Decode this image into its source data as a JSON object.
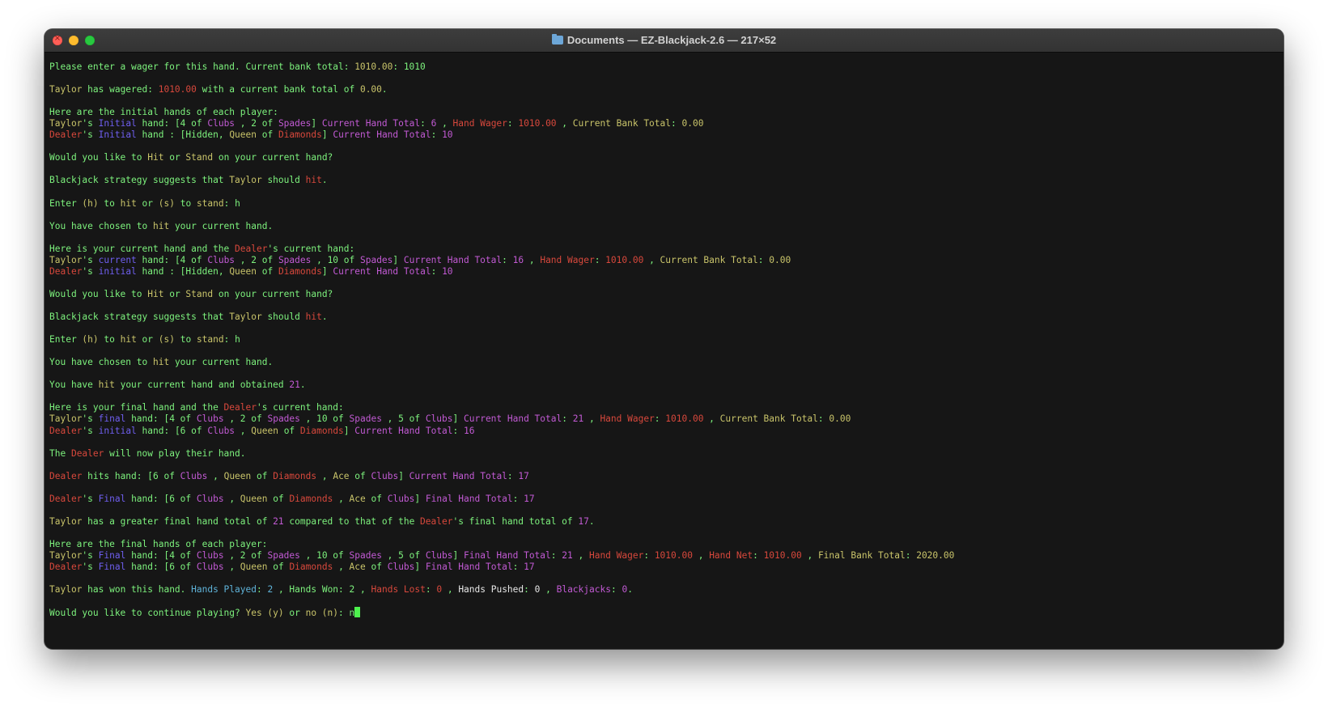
{
  "window": {
    "title": "Documents — EZ-Blackjack-2.6 — 217×52"
  },
  "colors": {
    "green": "#7df27d",
    "yellow": "#c9c46a",
    "red": "#d8483c",
    "purple": "#c25ad4",
    "blue": "#6f5ff0",
    "cyan": "#5fb3d9"
  },
  "terminal": {
    "lines": [
      [
        [
          "g",
          "Please enter a wager for this hand. Current bank total: "
        ],
        [
          "y",
          "1010.00"
        ],
        [
          "g",
          ": 1010"
        ]
      ],
      [],
      [
        [
          "y",
          "Taylor"
        ],
        [
          "g",
          " has wagered: "
        ],
        [
          "r",
          "1010.00"
        ],
        [
          "g",
          " with a current bank total of "
        ],
        [
          "y",
          "0.00"
        ],
        [
          "g",
          "."
        ]
      ],
      [],
      [
        [
          "g",
          "Here are the initial hands of each player:"
        ]
      ],
      [
        [
          "y",
          "Taylor"
        ],
        [
          "g",
          "'s "
        ],
        [
          "b",
          "Initial"
        ],
        [
          "g",
          " hand: [4 of "
        ],
        [
          "p",
          "Clubs"
        ],
        [
          "g",
          " , 2 of "
        ],
        [
          "p",
          "Spades"
        ],
        [
          "g",
          "] "
        ],
        [
          "p",
          "Current Hand Total"
        ],
        [
          "g",
          ": "
        ],
        [
          "p",
          "6"
        ],
        [
          "g",
          " , "
        ],
        [
          "r",
          "Hand Wager"
        ],
        [
          "g",
          ": "
        ],
        [
          "r",
          "1010.00"
        ],
        [
          "g",
          " , "
        ],
        [
          "y",
          "Current Bank Total"
        ],
        [
          "g",
          ": "
        ],
        [
          "y",
          "0.00"
        ]
      ],
      [
        [
          "r",
          "Dealer"
        ],
        [
          "g",
          "'s "
        ],
        [
          "b",
          "Initial"
        ],
        [
          "g",
          " hand : [Hidden, "
        ],
        [
          "y",
          "Queen"
        ],
        [
          "g",
          " of "
        ],
        [
          "r",
          "Diamonds"
        ],
        [
          "g",
          "] "
        ],
        [
          "p",
          "Current Hand Total"
        ],
        [
          "g",
          ": "
        ],
        [
          "p",
          "10"
        ]
      ],
      [],
      [
        [
          "g",
          "Would you like to "
        ],
        [
          "y",
          "Hit"
        ],
        [
          "g",
          " or "
        ],
        [
          "y",
          "Stand"
        ],
        [
          "g",
          " on your current hand?"
        ]
      ],
      [],
      [
        [
          "g",
          "Blackjack strategy suggests that "
        ],
        [
          "y",
          "Taylor"
        ],
        [
          "g",
          " should "
        ],
        [
          "r",
          "hit"
        ],
        [
          "g",
          "."
        ]
      ],
      [],
      [
        [
          "g",
          "Enter "
        ],
        [
          "y",
          "(h)"
        ],
        [
          "g",
          " to "
        ],
        [
          "y",
          "hit"
        ],
        [
          "g",
          " or "
        ],
        [
          "y",
          "(s)"
        ],
        [
          "g",
          " to "
        ],
        [
          "y",
          "stand"
        ],
        [
          "g",
          ": h"
        ]
      ],
      [],
      [
        [
          "g",
          "You have chosen to "
        ],
        [
          "y",
          "hit"
        ],
        [
          "g",
          " your current hand."
        ]
      ],
      [],
      [
        [
          "g",
          "Here is your current hand and the "
        ],
        [
          "r",
          "Dealer"
        ],
        [
          "g",
          "'s current hand:"
        ]
      ],
      [
        [
          "y",
          "Taylor"
        ],
        [
          "g",
          "'s "
        ],
        [
          "b",
          "current"
        ],
        [
          "g",
          " hand: [4 of "
        ],
        [
          "p",
          "Clubs"
        ],
        [
          "g",
          " , 2 of "
        ],
        [
          "p",
          "Spades"
        ],
        [
          "g",
          " , 10 of "
        ],
        [
          "p",
          "Spades"
        ],
        [
          "g",
          "] "
        ],
        [
          "p",
          "Current Hand Total"
        ],
        [
          "g",
          ": "
        ],
        [
          "p",
          "16"
        ],
        [
          "g",
          " , "
        ],
        [
          "r",
          "Hand Wager"
        ],
        [
          "g",
          ": "
        ],
        [
          "r",
          "1010.00"
        ],
        [
          "g",
          " , "
        ],
        [
          "y",
          "Current Bank Total"
        ],
        [
          "g",
          ": "
        ],
        [
          "y",
          "0.00"
        ]
      ],
      [
        [
          "r",
          "Dealer"
        ],
        [
          "g",
          "'s "
        ],
        [
          "b",
          "initial"
        ],
        [
          "g",
          " hand : [Hidden, "
        ],
        [
          "y",
          "Queen"
        ],
        [
          "g",
          " of "
        ],
        [
          "r",
          "Diamonds"
        ],
        [
          "g",
          "] "
        ],
        [
          "p",
          "Current Hand Total"
        ],
        [
          "g",
          ": "
        ],
        [
          "p",
          "10"
        ]
      ],
      [],
      [
        [
          "g",
          "Would you like to "
        ],
        [
          "y",
          "Hit"
        ],
        [
          "g",
          " or "
        ],
        [
          "y",
          "Stand"
        ],
        [
          "g",
          " on your current hand?"
        ]
      ],
      [],
      [
        [
          "g",
          "Blackjack strategy suggests that "
        ],
        [
          "y",
          "Taylor"
        ],
        [
          "g",
          " should "
        ],
        [
          "r",
          "hit"
        ],
        [
          "g",
          "."
        ]
      ],
      [],
      [
        [
          "g",
          "Enter "
        ],
        [
          "y",
          "(h)"
        ],
        [
          "g",
          " to "
        ],
        [
          "y",
          "hit"
        ],
        [
          "g",
          " or "
        ],
        [
          "y",
          "(s)"
        ],
        [
          "g",
          " to "
        ],
        [
          "y",
          "stand"
        ],
        [
          "g",
          ": h"
        ]
      ],
      [],
      [
        [
          "g",
          "You have chosen to "
        ],
        [
          "y",
          "hit"
        ],
        [
          "g",
          " your current hand."
        ]
      ],
      [],
      [
        [
          "g",
          "You have "
        ],
        [
          "y",
          "hit"
        ],
        [
          "g",
          " your current hand and obtained "
        ],
        [
          "p",
          "21"
        ],
        [
          "g",
          "."
        ]
      ],
      [],
      [
        [
          "g",
          "Here is your final hand and the "
        ],
        [
          "r",
          "Dealer"
        ],
        [
          "g",
          "'s current hand:"
        ]
      ],
      [
        [
          "y",
          "Taylor"
        ],
        [
          "g",
          "'s "
        ],
        [
          "b",
          "final"
        ],
        [
          "g",
          " hand: [4 of "
        ],
        [
          "p",
          "Clubs"
        ],
        [
          "g",
          " , 2 of "
        ],
        [
          "p",
          "Spades"
        ],
        [
          "g",
          " , 10 of "
        ],
        [
          "p",
          "Spades"
        ],
        [
          "g",
          " , 5 of "
        ],
        [
          "p",
          "Clubs"
        ],
        [
          "g",
          "] "
        ],
        [
          "p",
          "Current Hand Total"
        ],
        [
          "g",
          ": "
        ],
        [
          "p",
          "21"
        ],
        [
          "g",
          " , "
        ],
        [
          "r",
          "Hand Wager"
        ],
        [
          "g",
          ": "
        ],
        [
          "r",
          "1010.00"
        ],
        [
          "g",
          " , "
        ],
        [
          "y",
          "Current Bank Total"
        ],
        [
          "g",
          ": "
        ],
        [
          "y",
          "0.00"
        ]
      ],
      [
        [
          "r",
          "Dealer"
        ],
        [
          "g",
          "'s "
        ],
        [
          "b",
          "initial"
        ],
        [
          "g",
          " hand: [6 of "
        ],
        [
          "p",
          "Clubs"
        ],
        [
          "g",
          " , "
        ],
        [
          "y",
          "Queen"
        ],
        [
          "g",
          " of "
        ],
        [
          "r",
          "Diamonds"
        ],
        [
          "g",
          "] "
        ],
        [
          "p",
          "Current Hand Total"
        ],
        [
          "g",
          ": "
        ],
        [
          "p",
          "16"
        ]
      ],
      [],
      [
        [
          "g",
          "The "
        ],
        [
          "r",
          "Dealer"
        ],
        [
          "g",
          " will now play their hand."
        ]
      ],
      [],
      [
        [
          "r",
          "Dealer"
        ],
        [
          "g",
          " hits hand: [6 of "
        ],
        [
          "p",
          "Clubs"
        ],
        [
          "g",
          " , "
        ],
        [
          "y",
          "Queen"
        ],
        [
          "g",
          " of "
        ],
        [
          "r",
          "Diamonds"
        ],
        [
          "g",
          " , "
        ],
        [
          "y",
          "Ace"
        ],
        [
          "g",
          " of "
        ],
        [
          "p",
          "Clubs"
        ],
        [
          "g",
          "] "
        ],
        [
          "p",
          "Current Hand Total"
        ],
        [
          "g",
          ": "
        ],
        [
          "p",
          "17"
        ]
      ],
      [],
      [
        [
          "r",
          "Dealer"
        ],
        [
          "g",
          "'s "
        ],
        [
          "b",
          "Final"
        ],
        [
          "g",
          " hand: [6 of "
        ],
        [
          "p",
          "Clubs"
        ],
        [
          "g",
          " , "
        ],
        [
          "y",
          "Queen"
        ],
        [
          "g",
          " of "
        ],
        [
          "r",
          "Diamonds"
        ],
        [
          "g",
          " , "
        ],
        [
          "y",
          "Ace"
        ],
        [
          "g",
          " of "
        ],
        [
          "p",
          "Clubs"
        ],
        [
          "g",
          "] "
        ],
        [
          "p",
          "Final Hand Total"
        ],
        [
          "g",
          ": "
        ],
        [
          "p",
          "17"
        ]
      ],
      [],
      [
        [
          "y",
          "Taylor"
        ],
        [
          "g",
          " has a greater final hand total of "
        ],
        [
          "p",
          "21"
        ],
        [
          "g",
          " compared to that of the "
        ],
        [
          "r",
          "Dealer"
        ],
        [
          "g",
          "'s final hand total of "
        ],
        [
          "p",
          "17"
        ],
        [
          "g",
          "."
        ]
      ],
      [],
      [
        [
          "g",
          "Here are the final hands of each player:"
        ]
      ],
      [
        [
          "y",
          "Taylor"
        ],
        [
          "g",
          "'s "
        ],
        [
          "b",
          "Final"
        ],
        [
          "g",
          " hand: [4 of "
        ],
        [
          "p",
          "Clubs"
        ],
        [
          "g",
          " , 2 of "
        ],
        [
          "p",
          "Spades"
        ],
        [
          "g",
          " , 10 of "
        ],
        [
          "p",
          "Spades"
        ],
        [
          "g",
          " , 5 of "
        ],
        [
          "p",
          "Clubs"
        ],
        [
          "g",
          "] "
        ],
        [
          "p",
          "Final Hand Total"
        ],
        [
          "g",
          ": "
        ],
        [
          "p",
          "21"
        ],
        [
          "g",
          " , "
        ],
        [
          "r",
          "Hand Wager"
        ],
        [
          "g",
          ": "
        ],
        [
          "r",
          "1010.00"
        ],
        [
          "g",
          " , "
        ],
        [
          "r",
          "Hand Net"
        ],
        [
          "g",
          ": "
        ],
        [
          "r",
          "1010.00"
        ],
        [
          "g",
          " , "
        ],
        [
          "y",
          "Final Bank Total"
        ],
        [
          "g",
          ": "
        ],
        [
          "y",
          "2020.00"
        ]
      ],
      [
        [
          "r",
          "Dealer"
        ],
        [
          "g",
          "'s "
        ],
        [
          "b",
          "Final"
        ],
        [
          "g",
          " hand: [6 of "
        ],
        [
          "p",
          "Clubs"
        ],
        [
          "g",
          " , "
        ],
        [
          "y",
          "Queen"
        ],
        [
          "g",
          " of "
        ],
        [
          "r",
          "Diamonds"
        ],
        [
          "g",
          " , "
        ],
        [
          "y",
          "Ace"
        ],
        [
          "g",
          " of "
        ],
        [
          "p",
          "Clubs"
        ],
        [
          "g",
          "] "
        ],
        [
          "p",
          "Final Hand Total"
        ],
        [
          "g",
          ": "
        ],
        [
          "p",
          "17"
        ]
      ],
      [],
      [
        [
          "y",
          "Taylor"
        ],
        [
          "g",
          " has won this hand. "
        ],
        [
          "c",
          "Hands Played"
        ],
        [
          "g",
          ": "
        ],
        [
          "c",
          "2"
        ],
        [
          "g",
          " , "
        ],
        [
          "g",
          "Hands Won"
        ],
        [
          "g",
          ": "
        ],
        [
          "g",
          "2"
        ],
        [
          "g",
          " , "
        ],
        [
          "r",
          "Hands Lost"
        ],
        [
          "g",
          ": "
        ],
        [
          "r",
          "0"
        ],
        [
          "g",
          " , "
        ],
        [
          "w",
          "Hands Pushed"
        ],
        [
          "g",
          ": "
        ],
        [
          "w",
          "0"
        ],
        [
          "g",
          " , "
        ],
        [
          "p",
          "Blackjacks"
        ],
        [
          "g",
          ": "
        ],
        [
          "p",
          "0"
        ],
        [
          "g",
          "."
        ]
      ],
      [],
      [
        [
          "g",
          "Would you like to continue playing? "
        ],
        [
          "y",
          "Yes (y)"
        ],
        [
          "g",
          " or "
        ],
        [
          "y",
          "no (n)"
        ],
        [
          "g",
          ": n"
        ]
      ]
    ]
  }
}
